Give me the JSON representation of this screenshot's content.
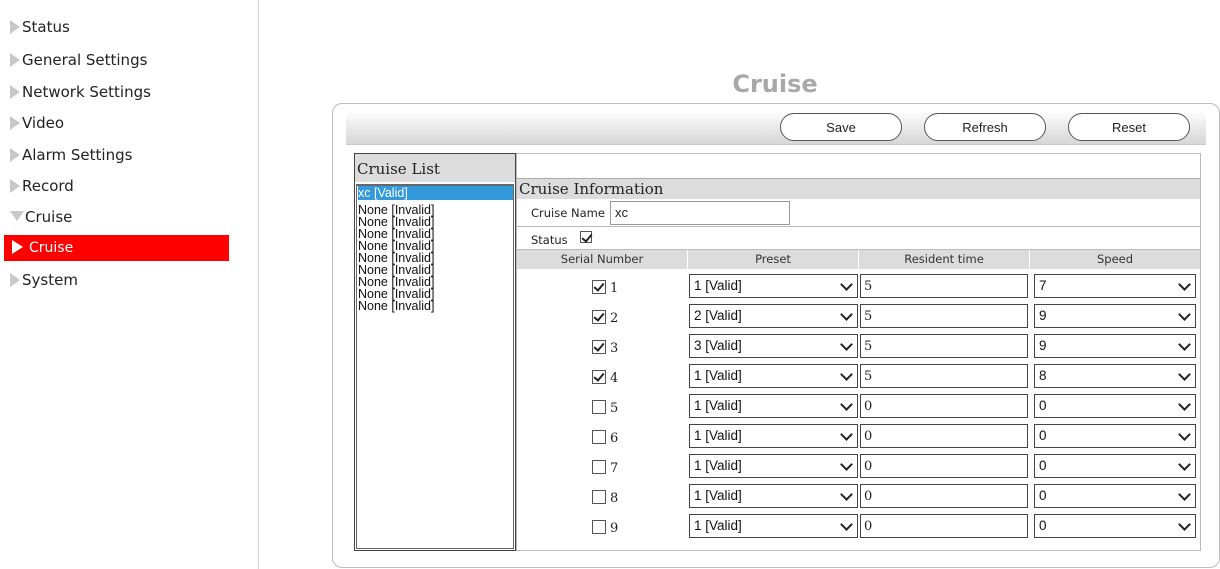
{
  "sidebar": {
    "items": [
      {
        "label": "Status"
      },
      {
        "label": "General Settings"
      },
      {
        "label": "Network Settings"
      },
      {
        "label": "Video"
      },
      {
        "label": "Alarm Settings"
      },
      {
        "label": "Record"
      },
      {
        "label": "Cruise"
      },
      {
        "label": "Cruise"
      },
      {
        "label": "System"
      }
    ]
  },
  "page": {
    "title": "Cruise"
  },
  "toolbar": {
    "save_label": "Save",
    "refresh_label": "Refresh",
    "reset_label": "Reset"
  },
  "cruise_list": {
    "header": "Cruise List",
    "items": [
      "xc [Valid]",
      "None [Invalid]",
      "None [Invalid]",
      "None [Invalid]",
      "None [Invalid]",
      "None [Invalid]",
      "None [Invalid]",
      "None [Invalid]",
      "None [Invalid]",
      "None [Invalid]"
    ],
    "selected_index": 0
  },
  "cruise_info": {
    "header": "Cruise Information",
    "name_label": "Cruise Name",
    "name_value": "xc",
    "status_label": "Status",
    "status_checked": true
  },
  "table": {
    "columns": [
      "Serial Number",
      "Preset",
      "Resident time",
      "Speed"
    ],
    "rows": [
      {
        "checked": true,
        "serial": "1",
        "preset": "1 [Valid]",
        "time": "5",
        "speed": "7"
      },
      {
        "checked": true,
        "serial": "2",
        "preset": "2 [Valid]",
        "time": "5",
        "speed": "9"
      },
      {
        "checked": true,
        "serial": "3",
        "preset": "3 [Valid]",
        "time": "5",
        "speed": "9"
      },
      {
        "checked": true,
        "serial": "4",
        "preset": "1 [Valid]",
        "time": "5",
        "speed": "8"
      },
      {
        "checked": false,
        "serial": "5",
        "preset": "1 [Valid]",
        "time": "0",
        "speed": "0"
      },
      {
        "checked": false,
        "serial": "6",
        "preset": "1 [Valid]",
        "time": "0",
        "speed": "0"
      },
      {
        "checked": false,
        "serial": "7",
        "preset": "1 [Valid]",
        "time": "0",
        "speed": "0"
      },
      {
        "checked": false,
        "serial": "8",
        "preset": "1 [Valid]",
        "time": "0",
        "speed": "0"
      },
      {
        "checked": false,
        "serial": "9",
        "preset": "1 [Valid]",
        "time": "0",
        "speed": "0"
      }
    ]
  },
  "colors": {
    "active_nav": "#ff0000",
    "selection": "#3399dd",
    "title": "#a8a8a8"
  }
}
